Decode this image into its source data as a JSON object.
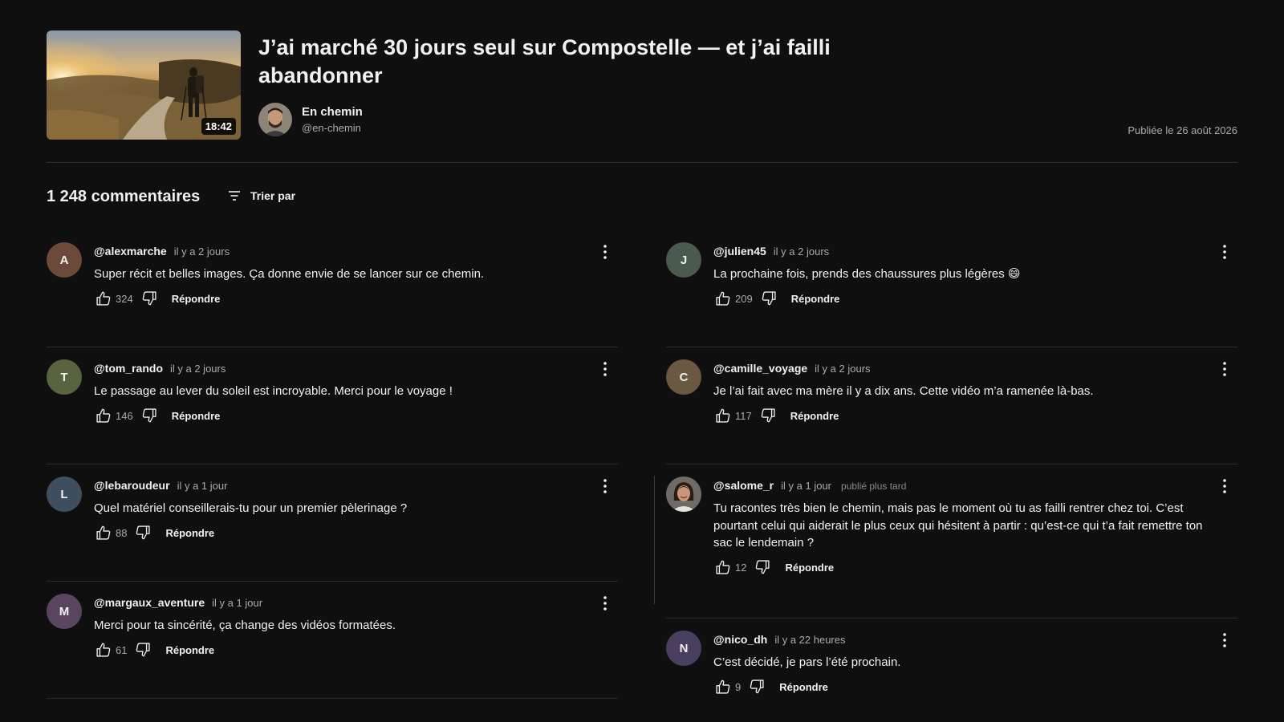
{
  "video": {
    "title": "J’ai marché 30 jours seul sur Compostelle — et j’ai failli abandonner",
    "duration": "18:42",
    "channel_name": "En chemin",
    "channel_handle": "@en-chemin",
    "published": "Publiée le 26 août 2026"
  },
  "comments_header": {
    "count_label": "1 248 commentaires",
    "sort_label": "Trier par"
  },
  "comments_left": [
    {
      "initial": "A",
      "author": "@alexmarche",
      "time": "il y a 2 jours",
      "text": "Super récit et belles images. Ça donne envie de se lancer sur ce chemin.",
      "likes": "324",
      "reply": "Répondre",
      "avatar_color": "#6b4a3c"
    },
    {
      "initial": "T",
      "author": "@tom_rando",
      "time": "il y a 2 jours",
      "text": "Le passage au lever du soleil est incroyable. Merci pour le voyage !",
      "likes": "146",
      "reply": "Répondre",
      "avatar_color": "#58633f"
    },
    {
      "initial": "L",
      "author": "@lebaroudeur",
      "time": "il y a 1 jour",
      "text": "Quel matériel conseillerais-tu pour un premier pèlerinage ?",
      "likes": "88",
      "reply": "Répondre",
      "avatar_color": "#3e4e5e"
    },
    {
      "initial": "M",
      "author": "@margaux_aventure",
      "time": "il y a 1 jour",
      "text": "Merci pour ta sincérité, ça change des vidéos formatées.",
      "likes": "61",
      "reply": "Répondre",
      "avatar_color": "#5a4560"
    }
  ],
  "comments_right": [
    {
      "initial": "J",
      "author": "@julien45",
      "time": "il y a 2 jours",
      "text": "La prochaine fois, prends des chaussures plus légères 😄",
      "likes": "209",
      "reply": "Répondre",
      "avatar_color": "#4b5a4e"
    },
    {
      "initial": "C",
      "author": "@camille_voyage",
      "time": "il y a 2 jours",
      "text": "Je l’ai fait avec ma mère il y a dix ans. Cette vidéo m’a ramenée là-bas.",
      "likes": "117",
      "reply": "Répondre",
      "avatar_color": "#6a5840"
    },
    {
      "initial": "",
      "author": "@salome_r",
      "time": "il y a 1 jour",
      "extra": "publié plus tard",
      "text": "Tu racontes très bien le chemin, mais pas le moment où tu as failli rentrer chez toi. C’est pourtant celui qui aiderait le plus ceux qui hésitent à partir : qu’est-ce qui t’a fait remettre ton sac le lendemain ?",
      "likes": "12",
      "reply": "Répondre",
      "avatar_color": "#4a3a30"
    },
    {
      "initial": "N",
      "author": "@nico_dh",
      "time": "il y a 22 heures",
      "text": "C’est décidé, je pars l’été prochain.",
      "likes": "9",
      "reply": "Répondre",
      "avatar_color": "#4a3f5e"
    }
  ],
  "icons": {
    "like": "thumb-up-icon",
    "dislike": "thumb-down-icon",
    "more": "more-vert-icon",
    "sort": "sort-icon"
  }
}
